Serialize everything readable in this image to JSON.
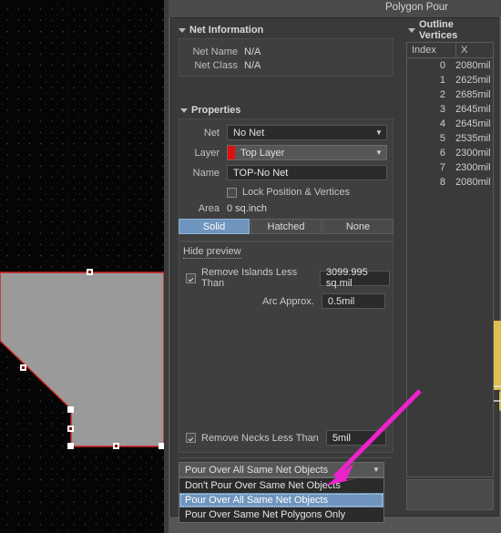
{
  "window": {
    "title": "Polygon Pour"
  },
  "net_information": {
    "header": "Net Information",
    "net_name_label": "Net Name",
    "net_name_value": "N/A",
    "net_class_label": "Net Class",
    "net_class_value": "N/A"
  },
  "properties": {
    "header": "Properties",
    "net_label": "Net",
    "net_value": "No Net",
    "layer_label": "Layer",
    "layer_value": "Top Layer",
    "layer_color": "#e01010",
    "name_label": "Name",
    "name_value": "TOP-No Net",
    "lock_label": "Lock Position & Vertices",
    "lock_checked": false,
    "area_label": "Area",
    "area_value": "0 sq.inch",
    "fill_modes": [
      {
        "label": "Solid",
        "selected": true
      },
      {
        "label": "Hatched",
        "selected": false
      },
      {
        "label": "None",
        "selected": false
      }
    ]
  },
  "preview": {
    "toggle_label": "Hide preview",
    "remove_islands_label": "Remove Islands Less Than",
    "remove_islands_checked": true,
    "remove_islands_value": "3099.995 sq.mil",
    "arc_approx_label": "Arc Approx.",
    "arc_approx_value": "0.5mil",
    "remove_necks_label": "Remove Necks Less Than",
    "remove_necks_checked": true,
    "remove_necks_value": "5mil"
  },
  "pour_over": {
    "selected": "Pour Over All Same Net Objects",
    "options": [
      {
        "label": "Don't Pour Over Same Net Objects",
        "selected": false
      },
      {
        "label": "Pour Over All Same Net Objects",
        "selected": true
      },
      {
        "label": "Pour Over Same Net Polygons Only",
        "selected": false
      }
    ]
  },
  "outline_vertices": {
    "header": "Outline Vertices",
    "columns": [
      "Index",
      "X"
    ],
    "rows": [
      {
        "index": "0",
        "x": "2080mil"
      },
      {
        "index": "1",
        "x": "2625mil"
      },
      {
        "index": "2",
        "x": "2685mil"
      },
      {
        "index": "3",
        "x": "2645mil"
      },
      {
        "index": "4",
        "x": "2645mil"
      },
      {
        "index": "5",
        "x": "2535mil"
      },
      {
        "index": "6",
        "x": "2300mil"
      },
      {
        "index": "7",
        "x": "2300mil"
      },
      {
        "index": "8",
        "x": "2080mil"
      }
    ]
  },
  "canvas": {
    "polygon_fill": "#9a9a9a",
    "polygon_outline": "#d02020",
    "vertex_handle_color": "#ffffff"
  },
  "annotation": {
    "arrow_color": "#ee22cc"
  }
}
